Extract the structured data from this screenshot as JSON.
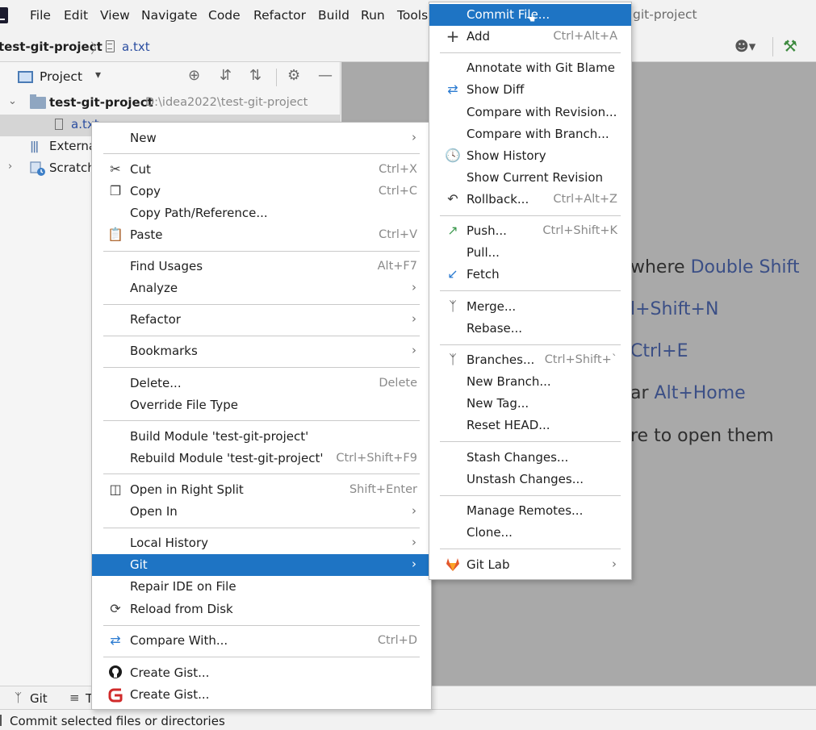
{
  "menubar": {
    "items": [
      "File",
      "Edit",
      "View",
      "Navigate",
      "Code",
      "Refactor",
      "Build",
      "Run",
      "Tools"
    ],
    "window_title": "git-project"
  },
  "breadcrumb": {
    "project": "test-git-project",
    "separator": "〉",
    "file": "a.txt"
  },
  "project_panel": {
    "title": "Project",
    "dropdown": "▾",
    "tree": {
      "root_name": "test-git-project",
      "root_path": "D:\\idea2022\\test-git-project",
      "file_name": "a.txt",
      "external_label": "Externa",
      "scratch_label": "Scratch"
    }
  },
  "editor_hints": [
    {
      "text": "where ",
      "key": "Double Shift"
    },
    {
      "text": "",
      "key": "l+Shift+N"
    },
    {
      "text": "",
      "key": "Ctrl+E"
    },
    {
      "text": "ar ",
      "key": "Alt+Home"
    },
    {
      "text": "re to open them",
      "key": ""
    }
  ],
  "tool_strip": {
    "git_label": "Git",
    "todo_label": "T"
  },
  "status_bar": {
    "text": "Commit selected files or directories"
  },
  "context_menu": {
    "new": "New",
    "cut": "Cut",
    "cut_shortcut": "Ctrl+X",
    "copy": "Copy",
    "copy_shortcut": "Ctrl+C",
    "copy_path": "Copy Path/Reference...",
    "paste": "Paste",
    "paste_shortcut": "Ctrl+V",
    "find_usages": "Find Usages",
    "find_usages_shortcut": "Alt+F7",
    "analyze": "Analyze",
    "refactor": "Refactor",
    "bookmarks": "Bookmarks",
    "delete": "Delete...",
    "delete_shortcut": "Delete",
    "override_file_type": "Override File Type",
    "build_module": "Build Module 'test-git-project'",
    "rebuild_module": "Rebuild Module 'test-git-project'",
    "rebuild_shortcut": "Ctrl+Shift+F9",
    "open_right_split": "Open in Right Split",
    "open_right_split_shortcut": "Shift+Enter",
    "open_in": "Open In",
    "local_history": "Local History",
    "git": "Git",
    "repair_ide": "Repair IDE on File",
    "reload_from_disk": "Reload from Disk",
    "compare_with": "Compare With...",
    "compare_with_shortcut": "Ctrl+D",
    "create_gist_github": "Create Gist...",
    "create_gist_gitee": "Create Gist..."
  },
  "git_submenu": {
    "commit_file": "Commit File...",
    "add": "Add",
    "add_shortcut": "Ctrl+Alt+A",
    "annotate": "Annotate with Git Blame",
    "show_diff": "Show Diff",
    "compare_revision": "Compare with Revision...",
    "compare_branch": "Compare with Branch...",
    "show_history": "Show History",
    "show_current_revision": "Show Current Revision",
    "rollback": "Rollback...",
    "rollback_shortcut": "Ctrl+Alt+Z",
    "push": "Push...",
    "push_shortcut": "Ctrl+Shift+K",
    "pull": "Pull...",
    "fetch": "Fetch",
    "merge": "Merge...",
    "rebase": "Rebase...",
    "branches": "Branches...",
    "branches_shortcut": "Ctrl+Shift+`",
    "new_branch": "New Branch...",
    "new_tag": "New Tag...",
    "reset_head": "Reset HEAD...",
    "stash": "Stash Changes...",
    "unstash": "Unstash Changes...",
    "manage_remotes": "Manage Remotes...",
    "clone": "Clone...",
    "gitlab": "Git Lab"
  },
  "icons": {
    "arrow": "›",
    "selection_color": "#1e74c4"
  }
}
